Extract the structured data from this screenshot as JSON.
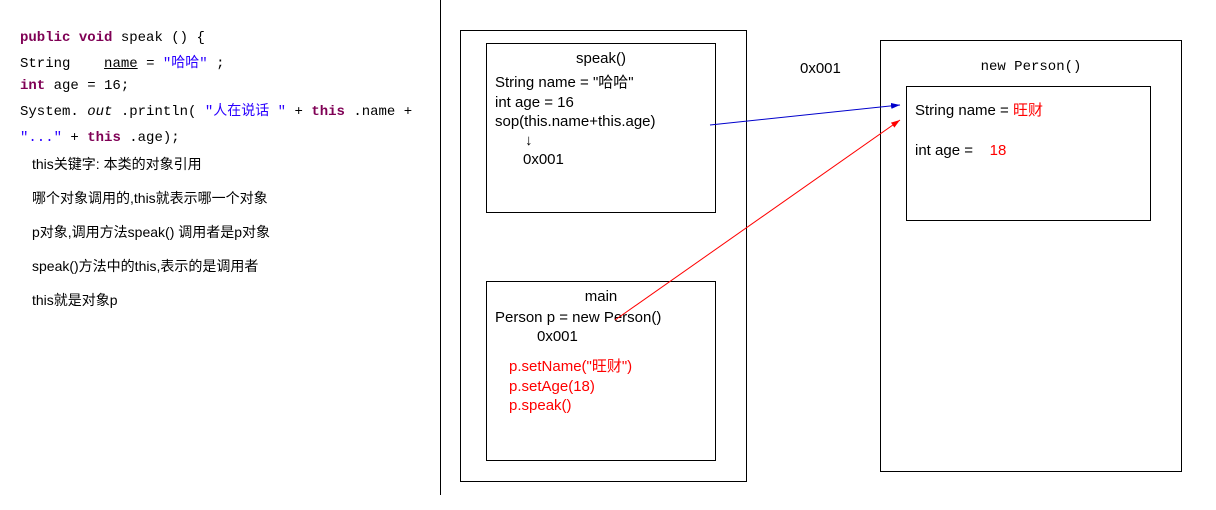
{
  "code": {
    "sig_public": "public",
    "sig_void": "void",
    "sig_name": "speak",
    "sig_parens": "() {",
    "l1_type": "String",
    "l1_var": "name",
    "l1_eq": " = ",
    "l1_val": "\"哈哈\"",
    "l1_end": ";",
    "l2_type": "int",
    "l2_var": " age = 16;",
    "l3_a": "System.",
    "l3_out": "out",
    "l3_b": ".println(",
    "l3_str1": "\"人在说话 \"",
    "l3_plus1": " + ",
    "l3_this1": "this",
    "l3_name": ".name +",
    "l4_str2": "\"...\"",
    "l4_plus2": " + ",
    "l4_this2": "this",
    "l4_age": ".age);"
  },
  "comments": {
    "c1": "this关键字: 本类的对象引用",
    "c2": "哪个对象调用的,this就表示哪一个对象",
    "c3": "p对象,调用方法speak()  调用者是p对象",
    "c4": "speak()方法中的this,表示的是调用者",
    "c5": "this就是对象p"
  },
  "diagram": {
    "addr": "0x001",
    "speak": {
      "title": "speak()",
      "l1": "String name = \"哈哈\"",
      "l2": "int age = 16",
      "l3": "sop(this.name+this.age)",
      "arrow": "↓",
      "addr": "0x001"
    },
    "main": {
      "title": "main",
      "l1": "Person p = new Person()",
      "addr": "0x001",
      "r1": "p.setName(\"旺财\")",
      "r2": "p.setAge(18)",
      "r3": "p.speak()"
    },
    "heap": {
      "title": "new Person()",
      "name_label": "String name =",
      "name_val": "旺财",
      "age_label": "int age =",
      "age_val": "18"
    }
  }
}
